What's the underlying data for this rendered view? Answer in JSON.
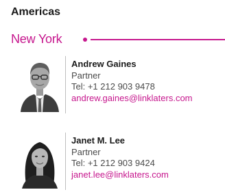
{
  "colors": {
    "accent": "#c6168d",
    "text": "#1a1a1a",
    "muted": "#4a4a4a",
    "divider": "#bdbdbd"
  },
  "region": {
    "title": "Americas"
  },
  "office": {
    "name": "New York"
  },
  "contacts": [
    {
      "name": "Andrew Gaines",
      "role": "Partner",
      "tel": "Tel: +1 212 903 9478",
      "email": "andrew.gaines@linklaters.com",
      "photo_icon": "headshot-photo"
    },
    {
      "name": "Janet M. Lee",
      "role": "Partner",
      "tel": "Tel: +1 212 903 9424",
      "email": "janet.lee@linklaters.com",
      "photo_icon": "headshot-photo"
    }
  ]
}
